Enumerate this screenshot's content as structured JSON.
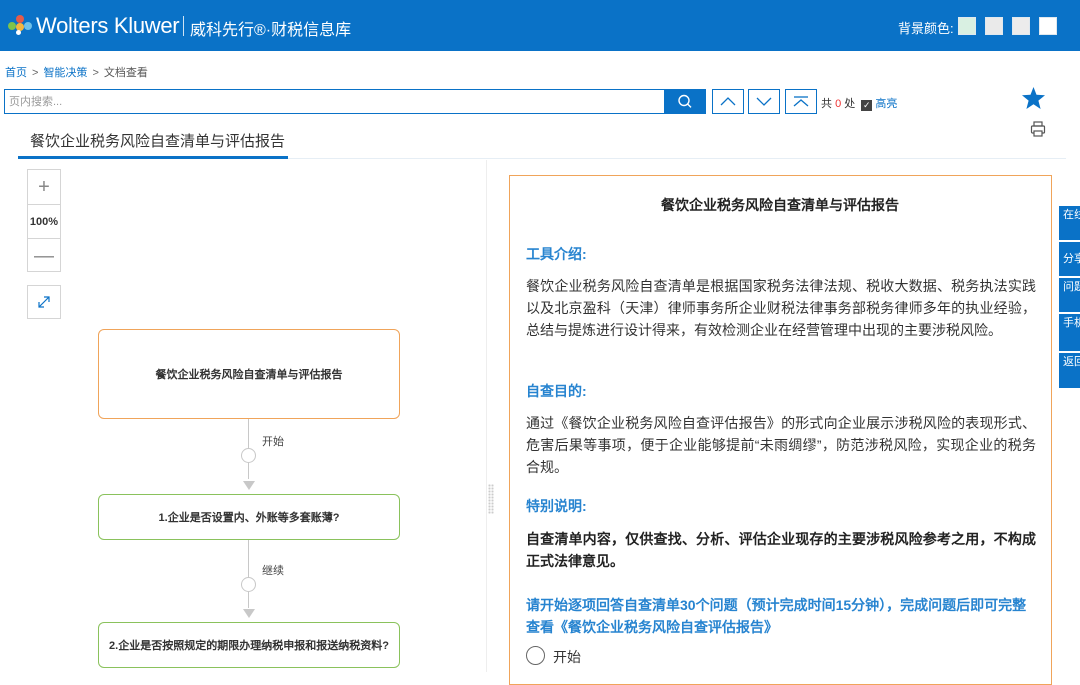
{
  "header": {
    "brand": "Wolters Kluwer",
    "product": "威科先行®·财税信息库",
    "bg_color_label": "背景颜色:",
    "swatches": [
      "#d9f0e2",
      "#eaeaea",
      "#ececec",
      "#ffffff"
    ]
  },
  "breadcrumb": {
    "home": "首页",
    "sep1": ">",
    "section": "智能决策",
    "sep2": ">",
    "current": "文档查看"
  },
  "search": {
    "placeholder": "页内搜索...",
    "count_prefix": "共",
    "count": "0",
    "count_suffix": "处",
    "highlight_label": "高亮"
  },
  "tab": {
    "title": "餐饮企业税务风险自查清单与评估报告"
  },
  "flow": {
    "zoom_plus": "+",
    "zoom_value": "100%",
    "zoom_minus": "—",
    "start_node": "餐饮企业税务风险自查清单与评估报告",
    "edge1": "开始",
    "q1": "1.企业是否设置内、外账等多套账薄?",
    "edge2": "继续",
    "q2": "2.企业是否按照规定的期限办理纳税申报和报送纳税资料?"
  },
  "doc": {
    "title": "餐饮企业税务风险自查清单与评估报告",
    "intro_heading": "工具介绍:",
    "intro_text": "餐饮企业税务风险自查清单是根据国家税务法律法规、税收大数据、税务执法实践以及北京盈科（天津）律师事务所企业财税法律事务部税务律师多年的执业经验，总结与提炼进行设计得来，有效检测企业在经营管理中出现的主要涉税风险。",
    "purpose_heading": "自查目的:",
    "purpose_text": "通过《餐饮企业税务风险自查评估报告》的形式向企业展示涉税风险的表现形式、危害后果等事项，便于企业能够提前“未雨绸缪”，防范涉税风险，实现企业的税务合规。",
    "note_heading": "特别说明:",
    "note_text": "自查清单内容，仅供查找、分析、评估企业现存的主要涉税风险参考之用，不构成正式法律意见。",
    "cta_text": "请开始逐项回答自查清单30个问题（预计完成时间15分钟），完成问题后即可完整查看《餐饮企业税务风险自查评估报告》",
    "start_option": "开始"
  },
  "side_tabs": [
    "在线客服",
    "分享",
    "问题反馈",
    "手机阅读",
    "返回顶部"
  ]
}
